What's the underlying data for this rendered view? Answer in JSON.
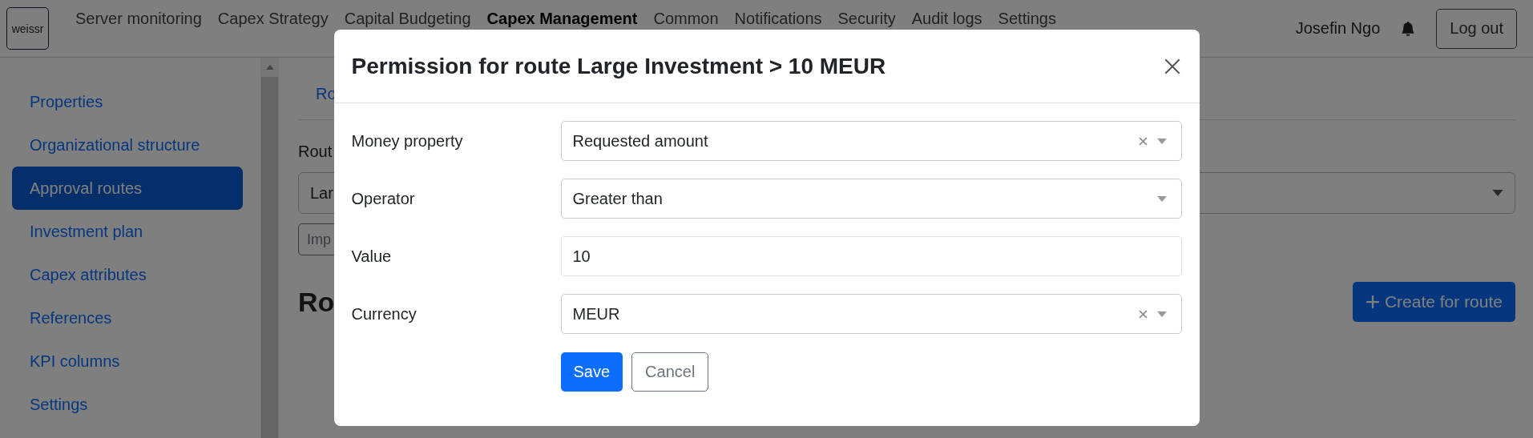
{
  "nav": {
    "logo": "weissr",
    "items": [
      {
        "label": "Server monitoring",
        "selected": false
      },
      {
        "label": "Capex Strategy",
        "selected": false
      },
      {
        "label": "Capital Budgeting",
        "selected": false
      },
      {
        "label": "Capex Management",
        "selected": true
      },
      {
        "label": "Common",
        "selected": false
      },
      {
        "label": "Notifications",
        "selected": false
      },
      {
        "label": "Security",
        "selected": false
      },
      {
        "label": "Audit logs",
        "selected": false
      },
      {
        "label": "Settings",
        "selected": false
      }
    ],
    "user": "Josefin Ngo",
    "logout": "Log out"
  },
  "sidebar": {
    "items": [
      {
        "label": "Properties",
        "selected": false
      },
      {
        "label": "Organizational structure",
        "selected": false
      },
      {
        "label": "Approval routes",
        "selected": true
      },
      {
        "label": "Investment plan",
        "selected": false
      },
      {
        "label": "Capex attributes",
        "selected": false
      },
      {
        "label": "References",
        "selected": false
      },
      {
        "label": "KPI columns",
        "selected": false
      },
      {
        "label": "Settings",
        "selected": false
      }
    ]
  },
  "main": {
    "tab": "Ro",
    "route_label": "Rout",
    "route_select": "Lar",
    "import_button": "Imp",
    "heading": "Ro",
    "create_button": "Create for route"
  },
  "modal": {
    "title": "Permission for route Large Investment > 10 MEUR",
    "fields": [
      {
        "label": "Money property",
        "kind": "select",
        "value": "Requested amount",
        "clearable": true
      },
      {
        "label": "Operator",
        "kind": "select",
        "value": "Greater than",
        "clearable": false
      },
      {
        "label": "Value",
        "kind": "input",
        "value": "10"
      },
      {
        "label": "Currency",
        "kind": "select",
        "value": "MEUR",
        "clearable": true
      }
    ],
    "save": "Save",
    "cancel": "Cancel"
  }
}
